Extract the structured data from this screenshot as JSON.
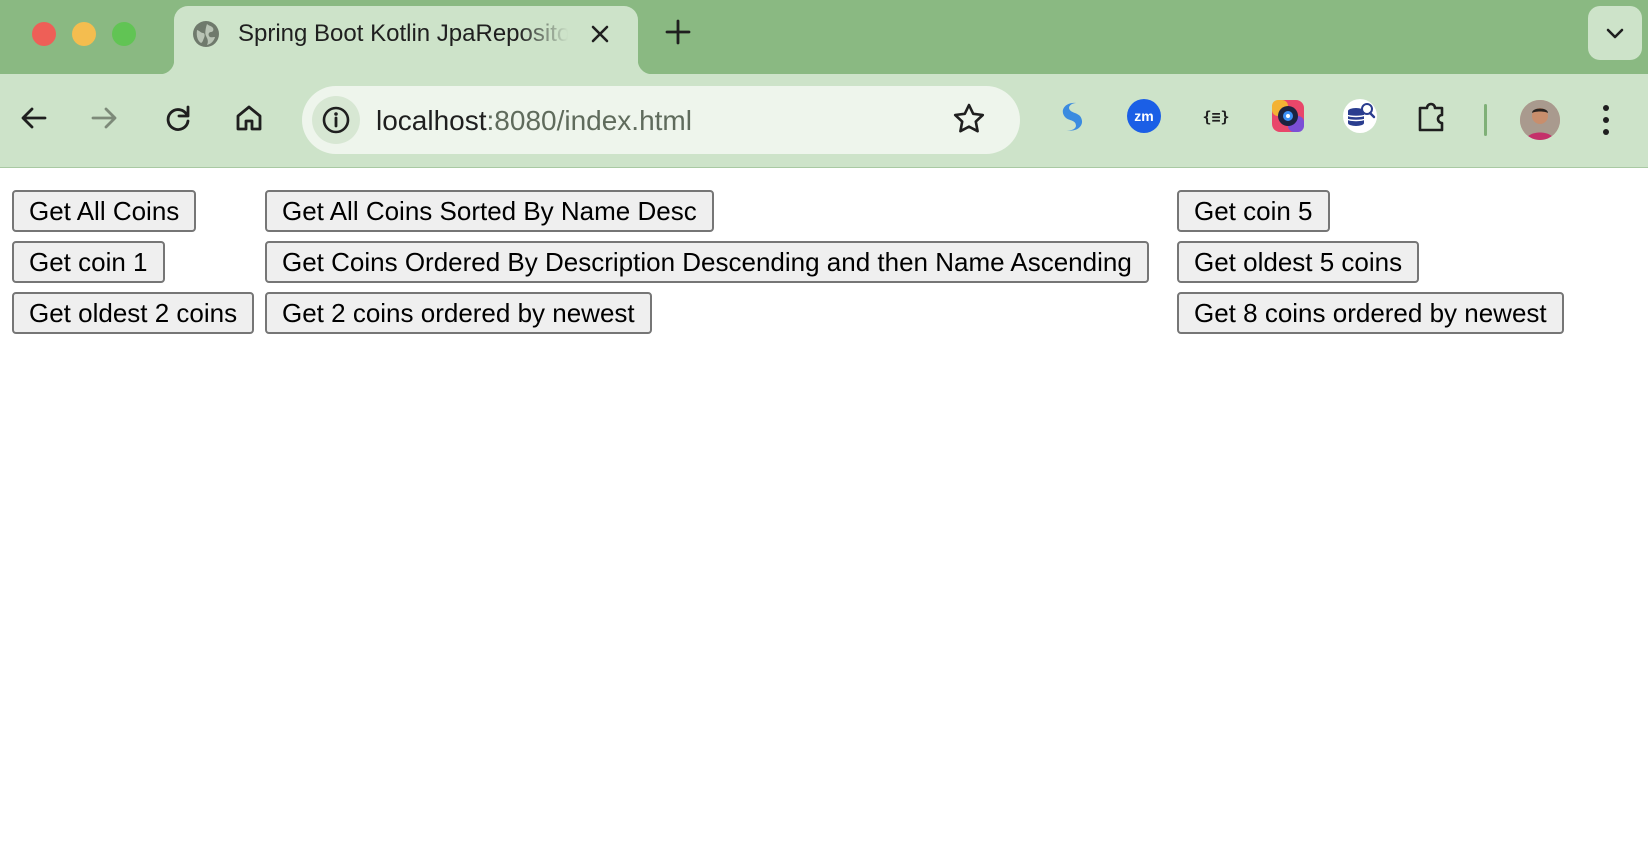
{
  "browser": {
    "tab": {
      "title": "Spring Boot Kotlin JpaRepository",
      "favicon": "globe-icon"
    },
    "address": {
      "host": "localhost",
      "rest": ":8080/index.html"
    },
    "colors": {
      "frame": "#8ab982",
      "toolbar": "#cde3c9",
      "omnibox": "#eef5ec"
    },
    "extensions": [
      "swirl-extension-icon",
      "zoom-extension-icon",
      "json-formatter-extension-icon",
      "camera-extension-icon",
      "database-search-extension-icon",
      "puzzle-extensions-icon"
    ]
  },
  "page": {
    "buttons": {
      "get_all_coins": "Get All Coins",
      "get_all_sorted_name_desc": "Get All Coins Sorted By Name Desc",
      "get_coin_5": "Get coin 5",
      "get_coin_1": "Get coin 1",
      "get_ordered_desc_name_asc": "Get Coins Ordered By Description Descending and then Name Ascending",
      "get_oldest_5": "Get oldest 5 coins",
      "get_oldest_2": "Get oldest 2 coins",
      "get_2_newest": "Get 2 coins ordered by newest",
      "get_8_newest": "Get 8 coins ordered by newest"
    }
  }
}
